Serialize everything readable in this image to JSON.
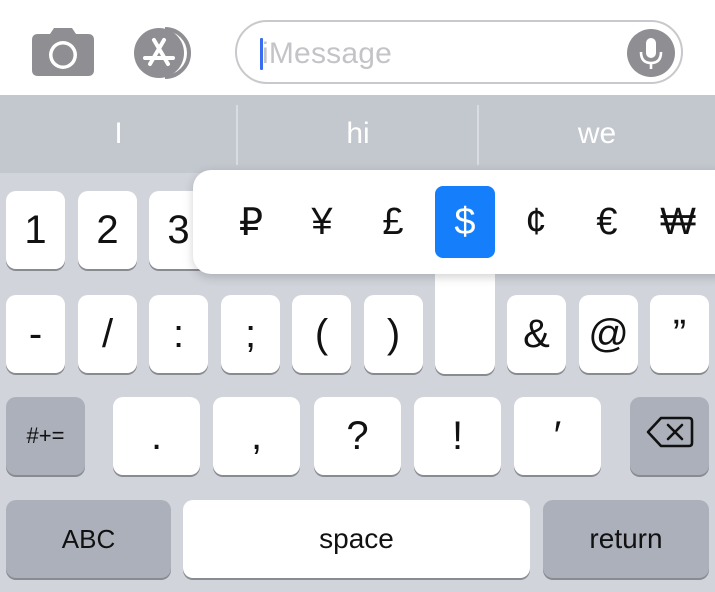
{
  "top": {
    "message_placeholder": "iMessage"
  },
  "predictions": [
    "I",
    "hi",
    "we"
  ],
  "rows": {
    "numbers": [
      "1",
      "2",
      "3"
    ],
    "symbols": [
      "-",
      "/",
      ":",
      ";",
      "(",
      ")",
      "&",
      "@",
      "”"
    ],
    "punct": [
      ".",
      ",",
      "?",
      "!",
      "′"
    ],
    "more_symbols": "#+=",
    "abc": "ABC",
    "space": "space",
    "return": "return"
  },
  "currency_popup": {
    "symbols": [
      "₽",
      "¥",
      "£",
      "$",
      "¢",
      "€",
      "₩"
    ],
    "selected": "$"
  },
  "colors": {
    "accent": "#147efb",
    "keyboard_bg": "#d1d4db",
    "gray_key": "#abb0ba"
  }
}
